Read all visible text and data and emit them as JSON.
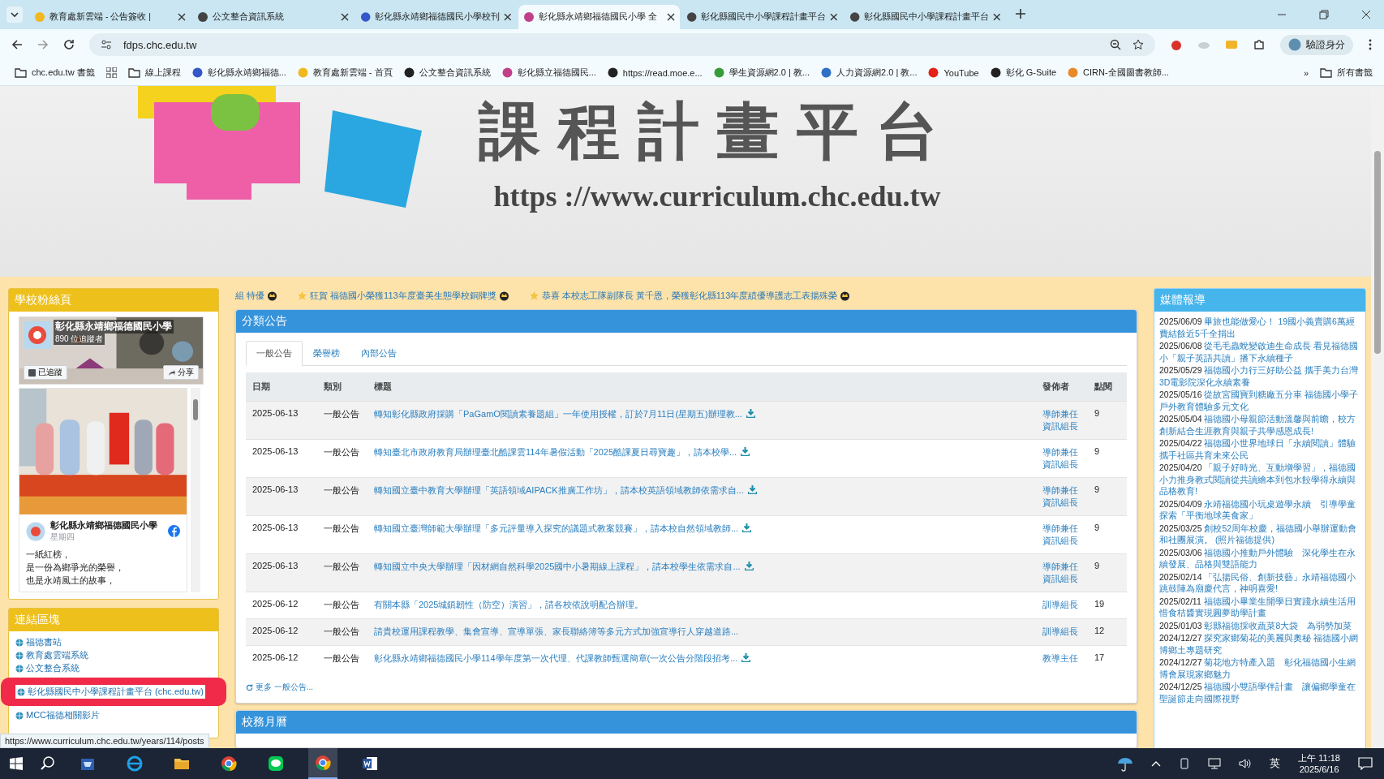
{
  "browser": {
    "tabs": [
      {
        "title": "教育處新雲端 - 公告簽收 |",
        "selected": false,
        "color": "#f2b820"
      },
      {
        "title": "公文整合資訊系統",
        "selected": false,
        "color": "#444444"
      },
      {
        "title": "彰化縣永靖鄉福德國民小學校刊",
        "selected": false,
        "color": "#3457c9"
      },
      {
        "title": "彰化縣永靖鄉福德國民小學 全",
        "selected": true,
        "color": "#c2408a"
      },
      {
        "title": "彰化縣國民中小學課程計畫平台",
        "selected": false,
        "color": "#444444"
      },
      {
        "title": "彰化縣國民中小學課程計畫平台",
        "selected": false,
        "color": "#444444"
      }
    ],
    "address": "fdps.chc.edu.tw",
    "profile": "驗證身分",
    "bookmarks": [
      {
        "label": "chc.edu.tw 書籤",
        "kind": "folder"
      },
      {
        "kind": "apps"
      },
      {
        "label": "線上課程",
        "kind": "folder"
      },
      {
        "label": "彰化縣永靖鄉福德...",
        "kind": "site",
        "color": "#3457c9"
      },
      {
        "label": "教育處新雲端 - 首頁",
        "kind": "site",
        "color": "#f2b820"
      },
      {
        "label": "公文整合資訊系統",
        "kind": "site",
        "color": "#222222"
      },
      {
        "label": "彰化縣立福德國民...",
        "kind": "site",
        "color": "#c2408a"
      },
      {
        "label": "https://read.moe.e...",
        "kind": "site",
        "color": "#222222"
      },
      {
        "label": "學生資源網2.0 | 教...",
        "kind": "site",
        "color": "#3a9a3a"
      },
      {
        "label": "人力資源網2.0 | 教...",
        "kind": "site",
        "color": "#2f6fc4"
      },
      {
        "label": "YouTube",
        "kind": "site",
        "color": "#e62117"
      },
      {
        "label": "彰化 G-Suite",
        "kind": "site",
        "color": "#222222"
      },
      {
        "label": "CIRN-全國圖書教師...",
        "kind": "site",
        "color": "#e88a2a"
      }
    ],
    "more": "»",
    "all_bookmarks": "所有書籤"
  },
  "banner": {
    "title": "課程計畫平台",
    "url": "https ://www.curriculum.chc.edu.tw"
  },
  "fan_page": {
    "header": "學校粉絲頁",
    "page_name": "彰化縣永靖鄉福德國民小學",
    "followers": "890 位追蹤者",
    "follow_button": "已追蹤",
    "share_button": "分享",
    "post": {
      "author": "彰化縣永靖鄉福德國民小學",
      "time": "星期四",
      "lines": [
        "一紙紅榜，",
        "是一份為鄉爭光的榮譽，",
        "也是永靖風土的故事，"
      ]
    }
  },
  "links": {
    "header": "連結區塊",
    "items": [
      {
        "label": "福德書站",
        "highlighted": false
      },
      {
        "label": "教育處雲端系統",
        "highlighted": false
      },
      {
        "label": "公文整合系統",
        "highlighted": false
      },
      {
        "label": "彰化縣國民中小學課程計畫平台 (chc.edu.tw)",
        "highlighted": true
      },
      {
        "label": "MCC福德相關影片",
        "highlighted": false
      }
    ]
  },
  "ticker": [
    {
      "text": "組 特優",
      "star": false
    },
    {
      "text": "狂賀 福德國小榮獲113年度臺美生態學校銅牌獎",
      "star": true
    },
    {
      "text": "恭喜 本校志工隊副隊長 黃千恩，榮獲彰化縣113年度績優導護志工表揚殊榮",
      "star": true
    }
  ],
  "announcements": {
    "header": "分類公告",
    "tabs": [
      {
        "label": "一般公告",
        "selected": true
      },
      {
        "label": "榮譽榜",
        "selected": false
      },
      {
        "label": "內部公告",
        "selected": false
      }
    ],
    "columns": [
      "日期",
      "類別",
      "標題",
      "發佈者",
      "點閱"
    ],
    "rows": [
      {
        "date": "2025-06-13",
        "category": "一般公告",
        "title": "轉知彰化縣政府採購「PaGamO閱讀素養題組」一年使用授權，訂於7月11日(星期五)辦理教...",
        "attachment": true,
        "publisher": "導師兼任資訊組長",
        "views": "9"
      },
      {
        "date": "2025-06-13",
        "category": "一般公告",
        "title": "轉知臺北市政府教育局辦理臺北酷課雲114年暑假活動「2025酷課夏日尋寶趣」，請本校學...",
        "attachment": true,
        "publisher": "導師兼任資訊組長",
        "views": "9"
      },
      {
        "date": "2025-06-13",
        "category": "一般公告",
        "title": "轉知國立臺中教育大學辦理「英語領域AIPACK推廣工作坊」，請本校英語領域教師依需求自...",
        "attachment": true,
        "publisher": "導師兼任資訊組長",
        "views": "9"
      },
      {
        "date": "2025-06-13",
        "category": "一般公告",
        "title": "轉知國立臺灣師範大學辦理「多元評量導入探究的議題式教案競賽」，請本校自然領域教師...",
        "attachment": true,
        "publisher": "導師兼任資訊組長",
        "views": "9"
      },
      {
        "date": "2025-06-13",
        "category": "一般公告",
        "title": "轉知國立中央大學辦理「因材網自然科學2025國中小暑期線上課程」，請本校學生依需求自...",
        "attachment": true,
        "publisher": "導師兼任資訊組長",
        "views": "9"
      },
      {
        "date": "2025-06-12",
        "category": "一般公告",
        "title": "有關本縣「2025城鎮韌性（防空）演習」，請各校依說明配合辦理。",
        "attachment": false,
        "publisher": "訓導組長",
        "views": "19"
      },
      {
        "date": "2025-06-12",
        "category": "一般公告",
        "title": "請貴校運用課程教學、集會宣導、宣導單張、家長聯絡簿等多元方式加強宣導行人穿越道路...",
        "attachment": false,
        "publisher": "訓導組長",
        "views": "12"
      },
      {
        "date": "2025-06-12",
        "category": "一般公告",
        "title": "彰化縣永靖鄉福德國民小學114學年度第一次代理、代課教師甄選簡章(一次公告分階段招考...",
        "attachment": true,
        "publisher": "教導主任",
        "views": "17"
      }
    ],
    "more": "更多 一般公告..."
  },
  "calendar": {
    "header": "校務月曆"
  },
  "media": {
    "header": "媒體報導",
    "items": [
      {
        "date": "2025/06/09",
        "title": "畢旅也能做愛心！ 19國小義賣購6萬經費結餘近5千全捐出"
      },
      {
        "date": "2025/06/08",
        "title": "從毛毛蟲蛻變啟迪生命成長 看見福德國小「親子英語共讀」播下永續種子"
      },
      {
        "date": "2025/05/29",
        "title": "福德國小力行三好助公益 攜手美力台灣3D電影院深化永續素養"
      },
      {
        "date": "2025/05/16",
        "title": "從故宮國寶到糖廠五分車 福德國小學子戶外教育體驗多元文化"
      },
      {
        "date": "2025/05/04",
        "title": "福德國小母親節活動溫馨與前瞻，校方創新結合生涯教育與親子共學感恩成長!"
      },
      {
        "date": "2025/04/22",
        "title": "福德國小世界地球日「永續閱讀」體驗攜手社區共育未來公民"
      },
      {
        "date": "2025/04/20",
        "title": "「親子好時光、互動增學習」，福德國小力推身教式閱讀從共讀繪本到包水餃學得永續與品格教育!"
      },
      {
        "date": "2025/04/09",
        "title": "永靖福德國小玩桌遊學永續　引導學童探索「平衡地球美食家」"
      },
      {
        "date": "2025/03/25",
        "title": "創校52周年校慶，福德國小舉辦運動會和社團展演。 (照片福德提供)"
      },
      {
        "date": "2025/03/06",
        "title": "福德國小推動戶外體驗　深化學生在永續發展、品格與雙語能力"
      },
      {
        "date": "2025/02/14",
        "title": "「弘揚民俗、創新技藝」永靖福德國小跳鼓陣為廟慶代言，神明喜愛!"
      },
      {
        "date": "2025/02/11",
        "title": "福德國小畢業生開學日實踐永續生活用惜食桔醬實現圓夢助學計畫"
      },
      {
        "date": "2025/01/03",
        "title": "彰縣福德採收蔬菜8大袋　為弱勢加菜"
      },
      {
        "date": "2024/12/27",
        "title": "探究家鄉菊花的美麗與奧秘 福德國小網博鄉土專題研究"
      },
      {
        "date": "2024/12/27",
        "title": "菊花地方特產入題　彰化福德國小生網博會展現家鄉魅力"
      },
      {
        "date": "2024/12/25",
        "title": "福德國小雙語學伴計畫　讓偏鄉學童在聖誕節走向國際視野"
      }
    ]
  },
  "status_url": "https://www.curriculum.chc.edu.tw/years/114/posts",
  "taskbar": {
    "apps": [
      {
        "kind": "store",
        "selected": false
      },
      {
        "kind": "ie",
        "selected": false
      },
      {
        "kind": "folder",
        "selected": false
      },
      {
        "kind": "chrome",
        "selected": false
      },
      {
        "kind": "line",
        "selected": false
      },
      {
        "kind": "chrome",
        "selected": true
      },
      {
        "kind": "word",
        "selected": false
      }
    ],
    "ime": "英",
    "time": "上午 11:18",
    "date": "2025/6/16"
  }
}
